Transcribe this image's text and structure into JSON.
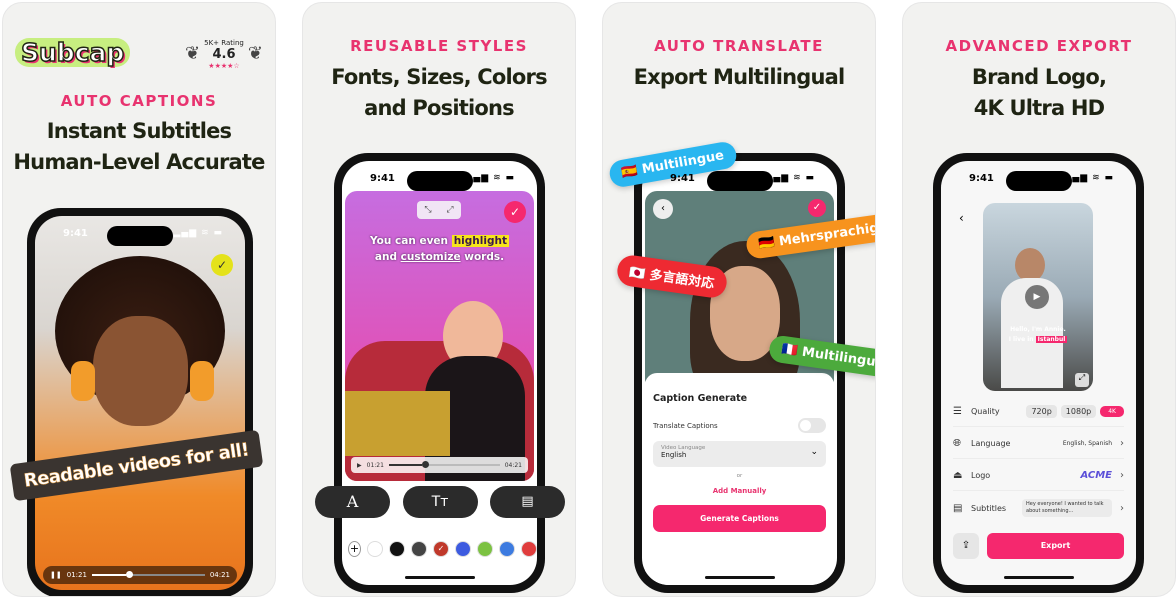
{
  "colors": {
    "accent": "#e8336f",
    "button": "#f5286e",
    "headline": "#1f2413"
  },
  "cards": [
    {
      "logo": "Subcap",
      "rating_label": "5K+ Rating",
      "rating_value": "4.6",
      "rating_stars": 4.5,
      "eyebrow": "AUTO CAPTIONS",
      "headline": [
        "Instant Subtitles",
        "Human-Level Accurate"
      ],
      "time": "9:41",
      "banner": "Readable videos for all!",
      "player": {
        "current": "01:21",
        "total": "04:21",
        "progress": 0.3
      }
    },
    {
      "eyebrow": "REUSABLE STYLES",
      "headline": [
        "Fonts, Sizes, Colors",
        "and Positions"
      ],
      "time": "9:41",
      "caption_line1": "You can even",
      "caption_highlight": "highlight",
      "caption_line2a": "and",
      "caption_underline": "customize",
      "caption_line2b": "words.",
      "player": {
        "current": "01:21",
        "total": "04:21",
        "progress": 0.3
      },
      "tools": [
        "font-icon",
        "text-size-icon",
        "position-icon"
      ],
      "swatches": [
        "#ffffff",
        "#111111",
        "#444444",
        "#c0392b",
        "#3d5be0",
        "#7cc242",
        "#3d7be0",
        "#e03d3d"
      ]
    },
    {
      "eyebrow": "AUTO TRANSLATE",
      "headline": [
        "Export Multilingual"
      ],
      "time": "9:41",
      "tags": [
        {
          "flag": "🇪🇸",
          "text": "Multilingue",
          "color": "#29b6f0"
        },
        {
          "flag": "🇩🇪",
          "text": "Mehrsprachig",
          "color": "#f7931e"
        },
        {
          "flag": "🇯🇵",
          "text": "多言語対応",
          "color": "#ee2a32"
        },
        {
          "flag": "🇫🇷",
          "text": "Multilingue",
          "color": "#4caa3c"
        }
      ],
      "sheet": {
        "title": "Caption Generate",
        "translate_label": "Translate Captions",
        "translate_on": false,
        "language_label": "Video Language",
        "language_value": "English",
        "or": "or",
        "add_manually": "Add Manually",
        "generate": "Generate Captions"
      }
    },
    {
      "eyebrow": "ADVANCED EXPORT",
      "headline": [
        "Brand Logo,",
        "4K Ultra HD"
      ],
      "time": "9:41",
      "video_caption1": "Hello, I'm Annie.",
      "video_caption2a": "I live in",
      "video_caption2b": "Istanbul",
      "settings": {
        "quality_label": "Quality",
        "quality_options": [
          "720p",
          "1080p",
          "4K"
        ],
        "language_label": "Language",
        "language_value": "English, Spanish",
        "logo_label": "Logo",
        "logo_value": "ACME",
        "subtitles_label": "Subtitles",
        "subtitles_value": "Hey everyone! I wanted to talk about something..."
      },
      "export": "Export"
    }
  ]
}
